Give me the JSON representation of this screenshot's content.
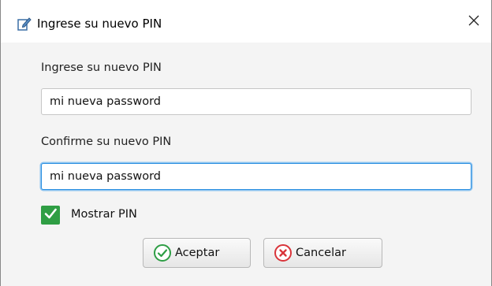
{
  "window": {
    "title": "Ingrese su nuevo PIN",
    "icon": "edit-icon",
    "close_icon": "close-icon"
  },
  "form": {
    "new_pin_label": "Ingrese su nuevo PIN",
    "new_pin_value": "mi nueva password",
    "confirm_pin_label": "Confirme su nuevo PIN",
    "confirm_pin_value": "mi nueva password",
    "show_pin_label": "Mostrar PIN",
    "show_pin_checked": true
  },
  "buttons": {
    "accept_label": "Aceptar",
    "accept_icon": "check-circle-icon",
    "cancel_label": "Cancelar",
    "cancel_icon": "x-circle-icon"
  },
  "colors": {
    "checkbox_green": "#2f9e44",
    "focus_blue": "#2b8fe0",
    "accept_icon_green": "#2e9e45",
    "cancel_icon_red": "#d9343a"
  }
}
